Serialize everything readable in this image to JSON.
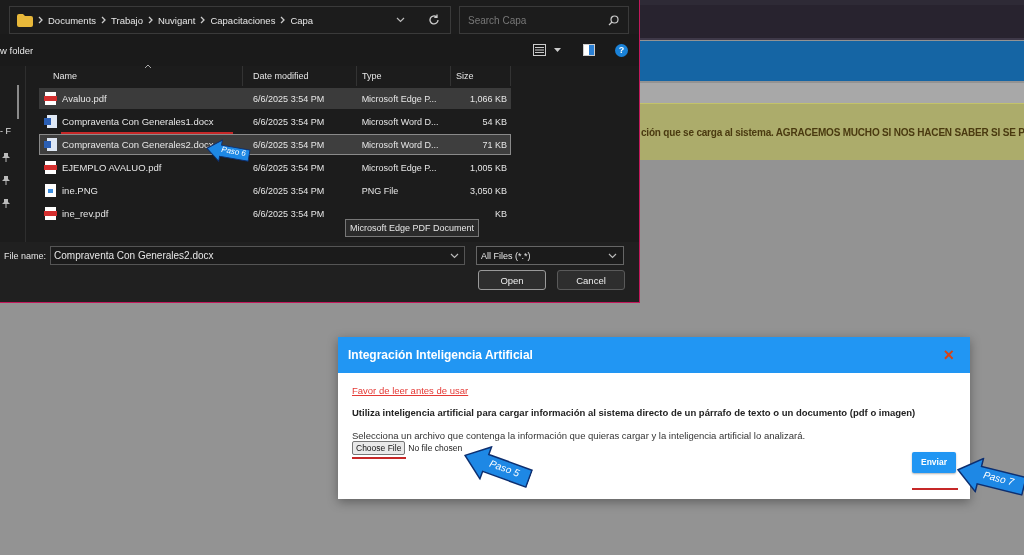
{
  "page": {
    "banner_text": "ción que se carga al sistema. AGRACEMOS MUCHO SI NOS HACEN SABER SI SE P"
  },
  "file_dialog": {
    "breadcrumb": [
      "Documents",
      "Trabajo",
      "Nuvigant",
      "Capacitaciones",
      "Capa"
    ],
    "search": {
      "placeholder": "Search Capa"
    },
    "toolbar": {
      "new_folder": "w folder",
      "help": "?"
    },
    "nav_label": "- F",
    "columns": [
      "Name",
      "Date modified",
      "Type",
      "Size"
    ],
    "rows": [
      {
        "name": "Avaluo.pdf",
        "kind": "pdf",
        "date": "6/6/2025 3:54 PM",
        "type": "Microsoft Edge P...",
        "size": "1,066 KB",
        "selected": false,
        "hovered": true
      },
      {
        "name": "Compraventa Con Generales1.docx",
        "kind": "word",
        "date": "6/6/2025 3:54 PM",
        "type": "Microsoft Word D...",
        "size": "54 KB",
        "selected": false,
        "hovered": false
      },
      {
        "name": "Compraventa Con Generales2.docx",
        "kind": "word",
        "date": "6/6/2025 3:54 PM",
        "type": "Microsoft Word D...",
        "size": "71 KB",
        "selected": true,
        "hovered": false
      },
      {
        "name": "EJEMPLO AVALUO.pdf",
        "kind": "pdf",
        "date": "6/6/2025 3:54 PM",
        "type": "Microsoft Edge P...",
        "size": "1,005 KB",
        "selected": false,
        "hovered": false
      },
      {
        "name": "ine.PNG",
        "kind": "image",
        "date": "6/6/2025 3:54 PM",
        "type": "PNG File",
        "size": "3,050 KB",
        "selected": false,
        "hovered": false
      },
      {
        "name": "ine_rev.pdf",
        "kind": "pdf",
        "date": "6/6/2025 3:54 PM",
        "size": "KB",
        "selected": false,
        "hovered": false
      }
    ],
    "tooltip": "Microsoft Edge PDF Document",
    "file_name_label": "File name:",
    "file_name_value": "Compraventa Con Generales2.docx",
    "filter": "All Files (*.*)",
    "buttons": [
      "Open",
      "Cancel"
    ]
  },
  "modal": {
    "title": "Integración Inteligencia Artificial",
    "close": "×",
    "link": "Favor de leer antes de usar",
    "heading": "Utiliza inteligencia artificial para cargar información al sistema directo de un párrafo de texto o un documento (pdf o imagen)",
    "instruction": "Selecciona un archivo que contenga la información que quieras cargar y la inteligencia artificial lo analizará.",
    "choose_button": "Choose File",
    "file_status": "No file chosen",
    "submit": "Enviar"
  },
  "annotations": [
    "Paso 6",
    "Paso 5",
    "Paso 7"
  ]
}
